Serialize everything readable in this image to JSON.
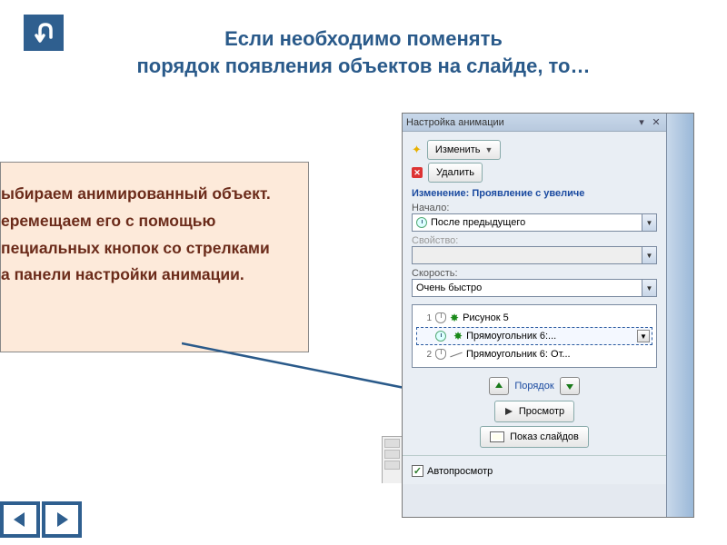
{
  "title_line1": "Если необходимо поменять",
  "title_line2": "порядок появления объектов на слайде, то…",
  "instruction": {
    "line1": "ыбираем анимированный объект.",
    "line2": "еремещаем его с помощью",
    "line3": "пециальных кнопок со стрелками",
    "line4": "а панели настройки анимации."
  },
  "panel": {
    "title": "Настройка анимации",
    "change_btn": "Изменить",
    "delete_btn": "Удалить",
    "section": "Изменение: Проявление с увеличе",
    "start_label": "Начало:",
    "start_value": "После предыдущего",
    "property_label": "Свойство:",
    "speed_label": "Скорость:",
    "speed_value": "Очень быстро",
    "items": [
      {
        "num": "1",
        "text": "Рисунок 5"
      },
      {
        "num": "",
        "text": "Прямоугольник 6:..."
      },
      {
        "num": "2",
        "text": "Прямоугольник 6: От..."
      }
    ],
    "order_label": "Порядок",
    "preview_btn": "Просмотр",
    "slideshow_btn": "Показ слайдов",
    "autopreview": "Автопросмотр"
  }
}
